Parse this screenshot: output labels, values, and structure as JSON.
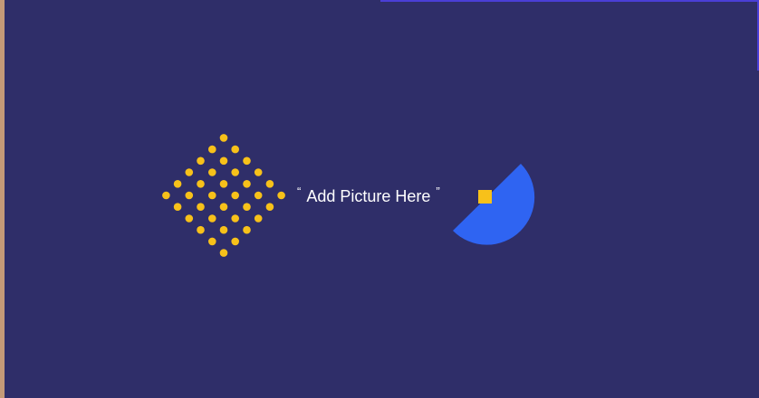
{
  "caption": {
    "open_quote": "“",
    "text": "Add Picture Here",
    "close_quote": "”"
  },
  "colors": {
    "background": "#2f2e69",
    "dots": "#f7c11a",
    "half_disc": "#2f64f2",
    "square": "#f7c11a",
    "accent_bar": "#4a3fd6"
  }
}
